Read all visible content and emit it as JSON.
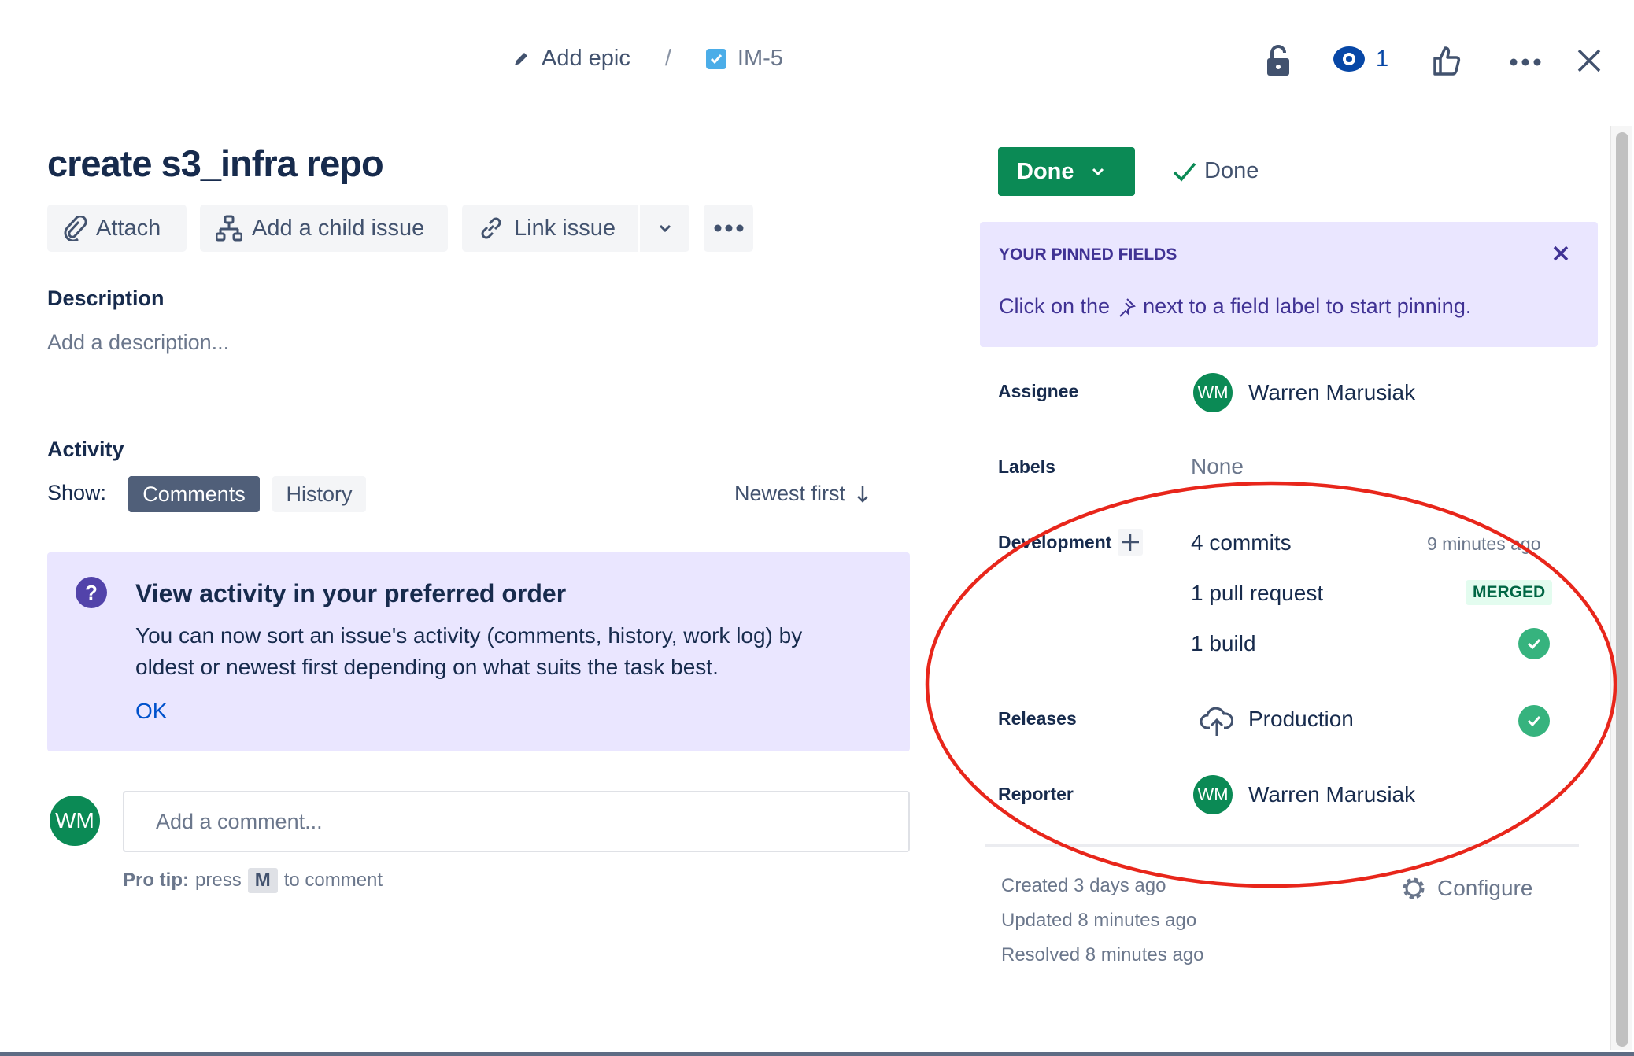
{
  "breadcrumb": {
    "epic": "Add epic",
    "separator": "/",
    "issue_key": "IM-5"
  },
  "header": {
    "watchers": "1"
  },
  "issue": {
    "title": "create s3_infra repo"
  },
  "toolbar": {
    "attach": "Attach",
    "add_child": "Add a child issue",
    "link_issue": "Link issue"
  },
  "description": {
    "heading": "Description",
    "placeholder": "Add a description..."
  },
  "activity": {
    "heading": "Activity",
    "show": "Show:",
    "tabs": [
      "Comments",
      "History"
    ],
    "sort": "Newest first"
  },
  "notice": {
    "title": "View activity in your preferred order",
    "line1": "You can now sort an issue's activity (comments, history, work log) by",
    "line2": "oldest or newest first depending on what suits the task best.",
    "ok": "OK"
  },
  "comment": {
    "avatar": "WM",
    "placeholder": "Add a comment...",
    "tip_bold": "Pro tip:",
    "tip_pre": "press",
    "tip_key": "M",
    "tip_post": "to comment"
  },
  "status": {
    "button": "Done",
    "resolution": "Done"
  },
  "pinned": {
    "title": "YOUR PINNED FIELDS",
    "text_pre": "Click on the",
    "text_post": "next to a field label to start pinning."
  },
  "fields": {
    "assignee": {
      "label": "Assignee",
      "initials": "WM",
      "name": "Warren Marusiak"
    },
    "labels": {
      "label": "Labels",
      "value": "None"
    },
    "development": {
      "label": "Development",
      "commits": "4 commits",
      "commits_time": "9 minutes ago",
      "pull": "1 pull request",
      "pull_status": "MERGED",
      "build": "1 build"
    },
    "releases": {
      "label": "Releases",
      "value": "Production"
    },
    "reporter": {
      "label": "Reporter",
      "initials": "WM",
      "name": "Warren Marusiak"
    }
  },
  "dates": {
    "created": "Created 3 days ago",
    "updated": "Updated 8 minutes ago",
    "resolved": "Resolved 8 minutes ago",
    "configure": "Configure"
  },
  "colors": {
    "done_green": "#0b8a55",
    "annotation_red": "#e8261b",
    "pinned_bg": "#eae6ff",
    "link_blue": "#0052cc"
  }
}
